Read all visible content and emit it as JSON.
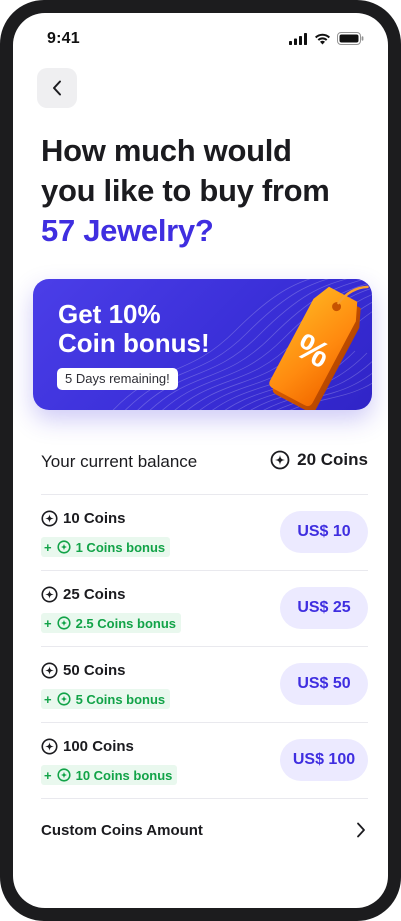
{
  "status_bar": {
    "time": "9:41"
  },
  "header": {
    "title_line1": "How much would",
    "title_line2": "you like to buy from",
    "store_name": "57 Jewelry?"
  },
  "promo": {
    "title_line1": "Get 10%",
    "title_line2": "Coin bonus!",
    "remaining": "5 Days remaining!",
    "tag_symbol": "%"
  },
  "balance": {
    "label": "Your current balance",
    "value": "20 Coins"
  },
  "packages": [
    {
      "name": "10 Coins",
      "bonus": "1 Coins bonus",
      "price": "US$ 10"
    },
    {
      "name": "25 Coins",
      "bonus": "2.5 Coins bonus",
      "price": "US$ 25"
    },
    {
      "name": "50 Coins",
      "bonus": "5 Coins bonus",
      "price": "US$ 50"
    },
    {
      "name": "100 Coins",
      "bonus": "10 Coins bonus",
      "price": "US$ 100"
    }
  ],
  "custom": {
    "label": "Custom Coins Amount"
  },
  "plus_sign": "+",
  "colors": {
    "accent": "#3f2ee0",
    "bonus_green": "#12a348",
    "price_bg": "#eceaff"
  }
}
